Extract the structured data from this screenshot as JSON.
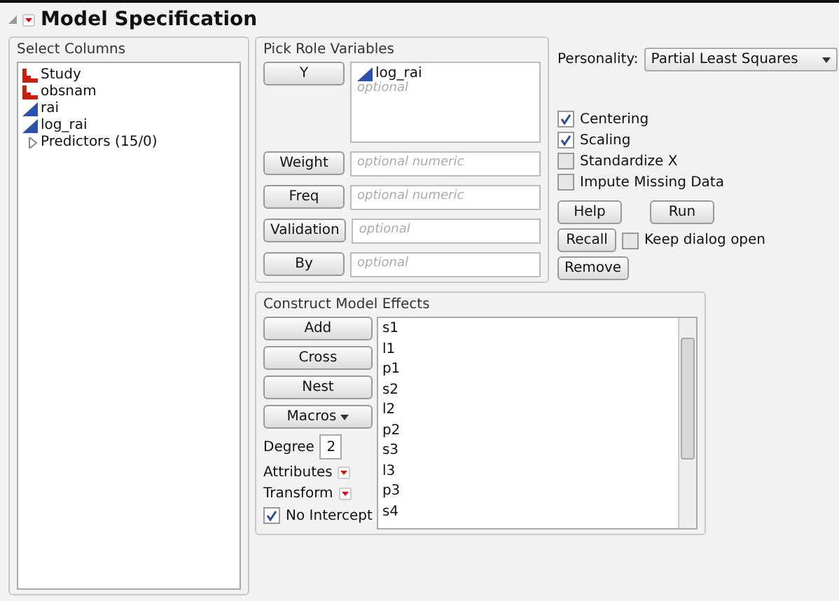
{
  "title": "Model Specification",
  "select_columns": {
    "title": "Select Columns",
    "items": [
      {
        "label": "Study",
        "kind": "nominal"
      },
      {
        "label": "obsnam",
        "kind": "nominal"
      },
      {
        "label": "rai",
        "kind": "continuous"
      },
      {
        "label": "log_rai",
        "kind": "continuous"
      },
      {
        "label": "Predictors (15/0)",
        "kind": "group",
        "expanded": false
      }
    ]
  },
  "pick_roles": {
    "title": "Pick Role Variables",
    "roles": [
      {
        "button": "Y",
        "values": [
          "log_rai"
        ],
        "placeholder": "optional"
      },
      {
        "button": "Weight",
        "placeholder": "optional numeric"
      },
      {
        "button": "Freq",
        "placeholder": "optional numeric"
      },
      {
        "button": "Validation",
        "placeholder": "optional"
      },
      {
        "button": "By",
        "placeholder": "optional"
      }
    ]
  },
  "personality": {
    "label": "Personality:",
    "value": "Partial Least Squares"
  },
  "options": [
    {
      "label": "Centering",
      "checked": true
    },
    {
      "label": "Scaling",
      "checked": true
    },
    {
      "label": "Standardize X",
      "checked": false
    },
    {
      "label": "Impute Missing Data",
      "checked": false
    }
  ],
  "actions": {
    "help": "Help",
    "run": "Run",
    "recall": "Recall",
    "remove": "Remove",
    "keep_open": {
      "label": "Keep dialog open",
      "checked": false
    }
  },
  "construct": {
    "title": "Construct Model Effects",
    "buttons": [
      "Add",
      "Cross",
      "Nest"
    ],
    "macros": "Macros",
    "degree": {
      "label": "Degree",
      "value": "2"
    },
    "attributes": "Attributes",
    "transform": "Transform",
    "no_intercept": {
      "label": "No Intercept",
      "checked": true
    },
    "effects": [
      "s1",
      "l1",
      "p1",
      "s2",
      "l2",
      "p2",
      "s3",
      "l3",
      "p3",
      "s4"
    ]
  }
}
